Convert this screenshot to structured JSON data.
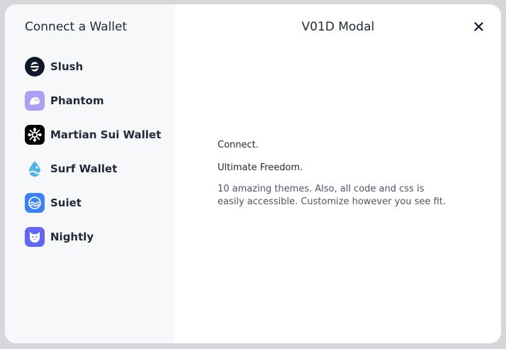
{
  "sidebar": {
    "title": "Connect a Wallet",
    "wallets": [
      {
        "label": "Slush",
        "icon": "slush-icon"
      },
      {
        "label": "Phantom",
        "icon": "phantom-icon"
      },
      {
        "label": "Martian Sui Wallet",
        "icon": "martian-icon"
      },
      {
        "label": "Surf Wallet",
        "icon": "surf-icon"
      },
      {
        "label": "Suiet",
        "icon": "suiet-icon"
      },
      {
        "label": "Nightly",
        "icon": "nightly-icon"
      }
    ]
  },
  "main": {
    "title": "V01D Modal",
    "close_icon": "close-icon",
    "line1": "Connect.",
    "line2": "Ultimate Freedom.",
    "description": "10 amazing themes. Also, all code and css is easily accessible. Customize however you see fit."
  },
  "colors": {
    "backdrop": "#d6d7da",
    "sidebar_bg": "#f7f8fa",
    "text": "#1f2937",
    "phantom": "#ab9ff2",
    "surf": "#4fb3e8",
    "suiet": "#3b82f6",
    "nightly": "#6366f1"
  }
}
